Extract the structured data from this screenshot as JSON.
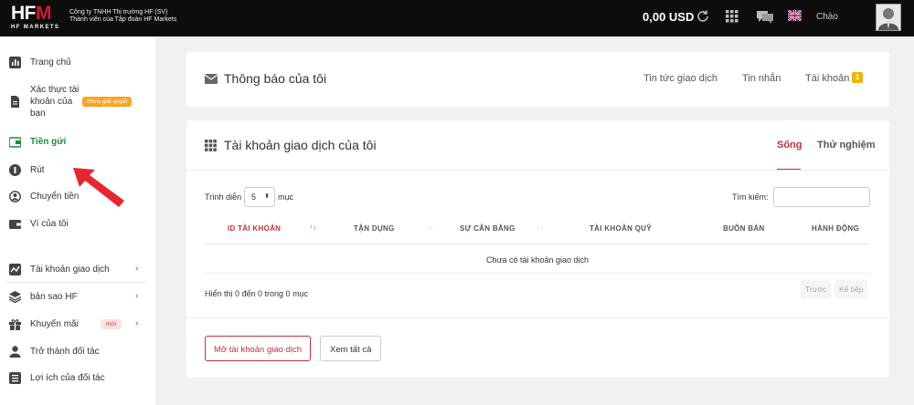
{
  "header": {
    "logo_text": "HFM",
    "logo_sub": "HF MARKETS",
    "company_line1": "Công ty TNHH Thị trường HF (SV)",
    "company_line2": "Thành viên của Tập đoàn HF Markets",
    "balance": "0,00 USD",
    "greeting": "Chào",
    "icons": [
      "refresh-icon",
      "apps-grid-icon",
      "chat-icon",
      "uk-flag-icon",
      "user-avatar"
    ]
  },
  "sidebar": {
    "items": [
      {
        "label": "Trang chủ",
        "icon": "bar-chart-icon"
      },
      {
        "label": "Xác thực tài khoản của bạn",
        "label_lines": [
          "Xác thực tài",
          "khoản của",
          "bạn"
        ],
        "icon": "document-icon",
        "badge": "chưa giải quyết"
      },
      {
        "label": "Tiền gửi",
        "icon": "wallet-icon",
        "active": true
      },
      {
        "label": "Rút",
        "icon": "withdraw-icon"
      },
      {
        "label": "Chuyển tiền",
        "icon": "transfer-icon"
      },
      {
        "label": "Ví của tôi",
        "icon": "wallet-icon"
      },
      {
        "label": "Tài khoản giao dịch",
        "icon": "line-chart-icon",
        "chevron": true
      },
      {
        "label": "bản sao HF",
        "icon": "layers-icon",
        "chevron": true
      },
      {
        "label": "Khuyến mãi",
        "icon": "gift-icon",
        "chevron": true,
        "badge": "mới"
      },
      {
        "label": "Trở thành đối tác",
        "icon": "person-icon"
      },
      {
        "label": "Lợi ích của đối tác",
        "icon": "list-icon"
      }
    ]
  },
  "notifications_card": {
    "title": "Thông báo của tôi",
    "links": [
      "Tin tức giao dịch",
      "Tin nhắn",
      "Tài khoản"
    ],
    "account_badge": "1"
  },
  "accounts_card": {
    "title": "Tài khoản giao dịch của tôi",
    "tabs": [
      "Sống",
      "Thử nghiệm"
    ],
    "active_tab": "Sống",
    "show_label": "Trình diễn",
    "entries_value": "5",
    "entries_suffix": "mục",
    "search_label": "Tìm kiếm:",
    "search_value": "",
    "columns": [
      "ID TÀI KHOẢN",
      "TẬN DỤNG",
      "SỰ CÂN BẰNG",
      "TÀI KHOẢN QUỸ",
      "BUÔN BÁN",
      "HÀNH ĐỘNG"
    ],
    "empty_message": "Chưa có tài khoản giao dịch",
    "info": "Hiển thị 0 đến 0 trong 0 mục",
    "pagination": [
      "Trước",
      "Kế tiếp"
    ],
    "buttons": [
      "Mở tài khoản giao dịch",
      "Xem tất cả"
    ]
  },
  "colors": {
    "topbar": "#0d0d0d",
    "brand_red": "#d3162d",
    "accent_red": "#c62f3b",
    "active_green": "#1c8c3c",
    "warn_badge": "#f5a623"
  }
}
